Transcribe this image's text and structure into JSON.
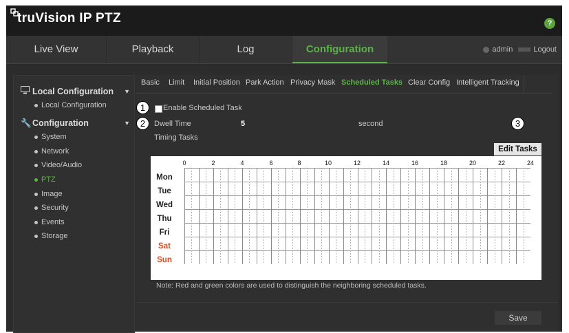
{
  "app": {
    "title": "truVision IP PTZ",
    "help_symbol": "?"
  },
  "nav": {
    "tabs": [
      {
        "label": "Live View"
      },
      {
        "label": "Playback"
      },
      {
        "label": "Log"
      },
      {
        "label": "Configuration"
      }
    ],
    "user": "admin",
    "logout": "Logout"
  },
  "sidebar": {
    "local_configuration": {
      "label": "Local Configuration",
      "items": [
        "Local Configuration"
      ]
    },
    "configuration": {
      "label": "Configuration",
      "items": [
        "System",
        "Network",
        "Video/Audio",
        "PTZ",
        "Image",
        "Security",
        "Events",
        "Storage"
      ],
      "active_item": "PTZ"
    }
  },
  "subtabs": [
    "Basic",
    "Limit",
    "Initial Position",
    "Park Action",
    "Privacy Mask",
    "Scheduled Tasks",
    "Clear Config",
    "Intelligent Tracking"
  ],
  "active_subtab": "Scheduled Tasks",
  "form": {
    "enable_label": "Enable Scheduled Task",
    "enable_checked": false,
    "dwell_label": "Dwell Time",
    "dwell_value": "5",
    "dwell_unit": "second",
    "timing_label": "Timing Tasks",
    "edit_button": "Edit Tasks"
  },
  "callouts": [
    "1",
    "2",
    "3"
  ],
  "schedule": {
    "hours": [
      "0",
      "2",
      "4",
      "6",
      "8",
      "10",
      "12",
      "14",
      "16",
      "18",
      "20",
      "22",
      "24"
    ],
    "days": [
      "Mon",
      "Tue",
      "Wed",
      "Thu",
      "Fri",
      "Sat",
      "Sun"
    ],
    "weekend_color": "#e0481c"
  },
  "note": "Note: Red and green colors are used to distinguish the neighboring scheduled tasks.",
  "save_button": "Save",
  "colors": {
    "accent_green": "#5ab345"
  }
}
